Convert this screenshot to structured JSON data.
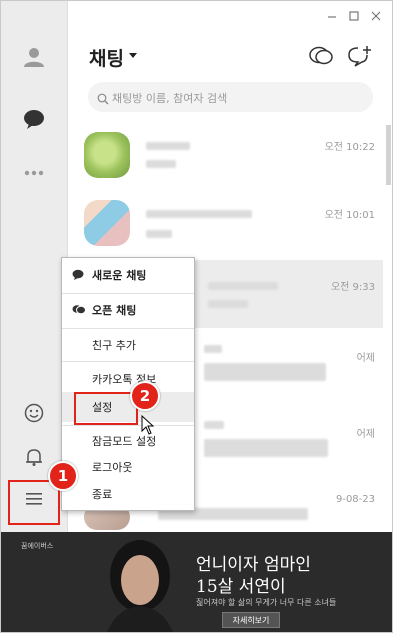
{
  "header": {
    "title": "채팅",
    "search_placeholder": "채팅방 이름, 참여자 검색"
  },
  "chat_rows": [
    {
      "time": "오전 10:22"
    },
    {
      "time": "오전 10:01"
    },
    {
      "time": "오전 9:33"
    },
    {
      "time": "어제"
    },
    {
      "time": "어제"
    },
    {
      "time": "9-08-23"
    }
  ],
  "menu": {
    "items": [
      {
        "label": "새로운 채팅"
      },
      {
        "label": "오픈 채팅"
      },
      {
        "label": "친구 추가"
      },
      {
        "label": "카카오톡 정보"
      },
      {
        "label": "설정"
      },
      {
        "label": "잠금모드 설정"
      },
      {
        "label": "로그아웃"
      },
      {
        "label": "종료"
      }
    ]
  },
  "annotations": {
    "badge1": "1",
    "badge2": "2",
    "accent": "#e2231a"
  },
  "ad": {
    "brand": "꿈에이버스",
    "title_line1": "언니이자 엄마인",
    "title_line2": "15살 서연이",
    "subtitle": "짊어져야 할 삶의 무게가 너무 다른 소녀들",
    "button": "자세히보기"
  }
}
